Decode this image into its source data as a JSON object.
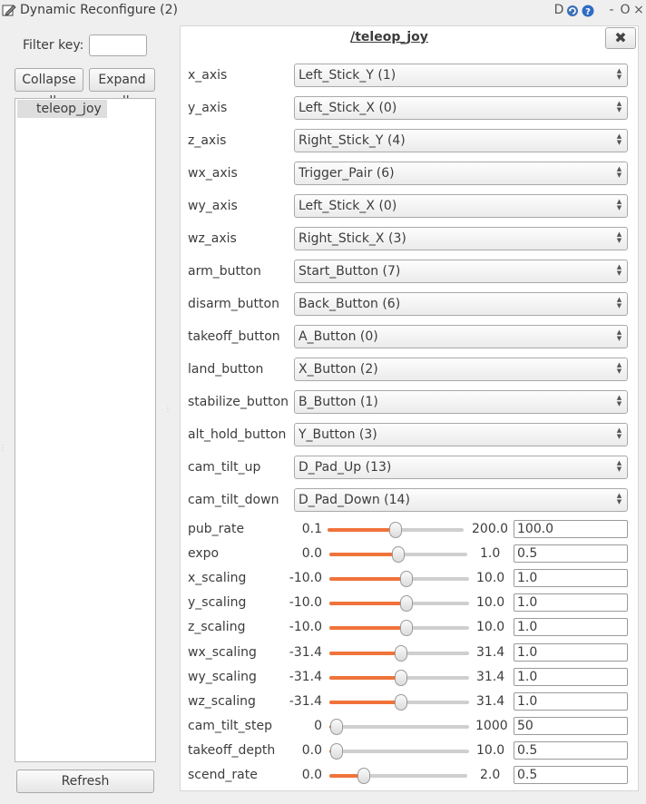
{
  "window": {
    "title": "Dynamic Reconfigure (2)",
    "titlebar_icons": [
      "d-icon",
      "reload-icon",
      "help-icon"
    ],
    "controls": [
      "-",
      "O",
      "×"
    ]
  },
  "left": {
    "filter_label": "Filter key:",
    "filter_value": "",
    "collapse_label": "Collapse all",
    "expand_label": "Expand all",
    "tree_items": [
      "teleop_joy"
    ],
    "refresh_label": "Refresh"
  },
  "node": {
    "title": "/teleop_joy",
    "close_label": "✖"
  },
  "enums": [
    {
      "name": "x_axis",
      "value": "Left_Stick_Y (1)"
    },
    {
      "name": "y_axis",
      "value": "Left_Stick_X (0)"
    },
    {
      "name": "z_axis",
      "value": "Right_Stick_Y (4)"
    },
    {
      "name": "wx_axis",
      "value": "Trigger_Pair (6)"
    },
    {
      "name": "wy_axis",
      "value": "Left_Stick_X (0)"
    },
    {
      "name": "wz_axis",
      "value": "Right_Stick_X (3)"
    },
    {
      "name": "arm_button",
      "value": "Start_Button (7)"
    },
    {
      "name": "disarm_button",
      "value": "Back_Button (6)"
    },
    {
      "name": "takeoff_button",
      "value": "A_Button (0)"
    },
    {
      "name": "land_button",
      "value": "X_Button (2)"
    },
    {
      "name": "stabilize_button",
      "value": "B_Button (1)"
    },
    {
      "name": "alt_hold_button",
      "value": "Y_Button (3)"
    },
    {
      "name": "cam_tilt_up",
      "value": "D_Pad_Up (13)"
    },
    {
      "name": "cam_tilt_down",
      "value": "D_Pad_Down (14)"
    }
  ],
  "sliders": [
    {
      "name": "pub_rate",
      "min": "0.1",
      "max": "200.0",
      "value": "100.0",
      "position": 0.5
    },
    {
      "name": "expo",
      "min": "0.0",
      "max": "1.0",
      "value": "0.5",
      "position": 0.5
    },
    {
      "name": "x_scaling",
      "min": "-10.0",
      "max": "10.0",
      "value": "1.0",
      "position": 0.55
    },
    {
      "name": "y_scaling",
      "min": "-10.0",
      "max": "10.0",
      "value": "1.0",
      "position": 0.55
    },
    {
      "name": "z_scaling",
      "min": "-10.0",
      "max": "10.0",
      "value": "1.0",
      "position": 0.55
    },
    {
      "name": "wx_scaling",
      "min": "-31.4",
      "max": "31.4",
      "value": "1.0",
      "position": 0.516
    },
    {
      "name": "wy_scaling",
      "min": "-31.4",
      "max": "31.4",
      "value": "1.0",
      "position": 0.516
    },
    {
      "name": "wz_scaling",
      "min": "-31.4",
      "max": "31.4",
      "value": "1.0",
      "position": 0.516
    },
    {
      "name": "cam_tilt_step",
      "min": "0",
      "max": "1000",
      "value": "50",
      "position": 0.05
    },
    {
      "name": "takeoff_depth",
      "min": "0.0",
      "max": "10.0",
      "value": "0.5",
      "position": 0.05
    },
    {
      "name": "scend_rate",
      "min": "0.0",
      "max": "2.0",
      "value": "0.5",
      "position": 0.25
    }
  ],
  "colors": {
    "slider_fill": "#f0733a",
    "slider_track": "#cfcfcf"
  }
}
